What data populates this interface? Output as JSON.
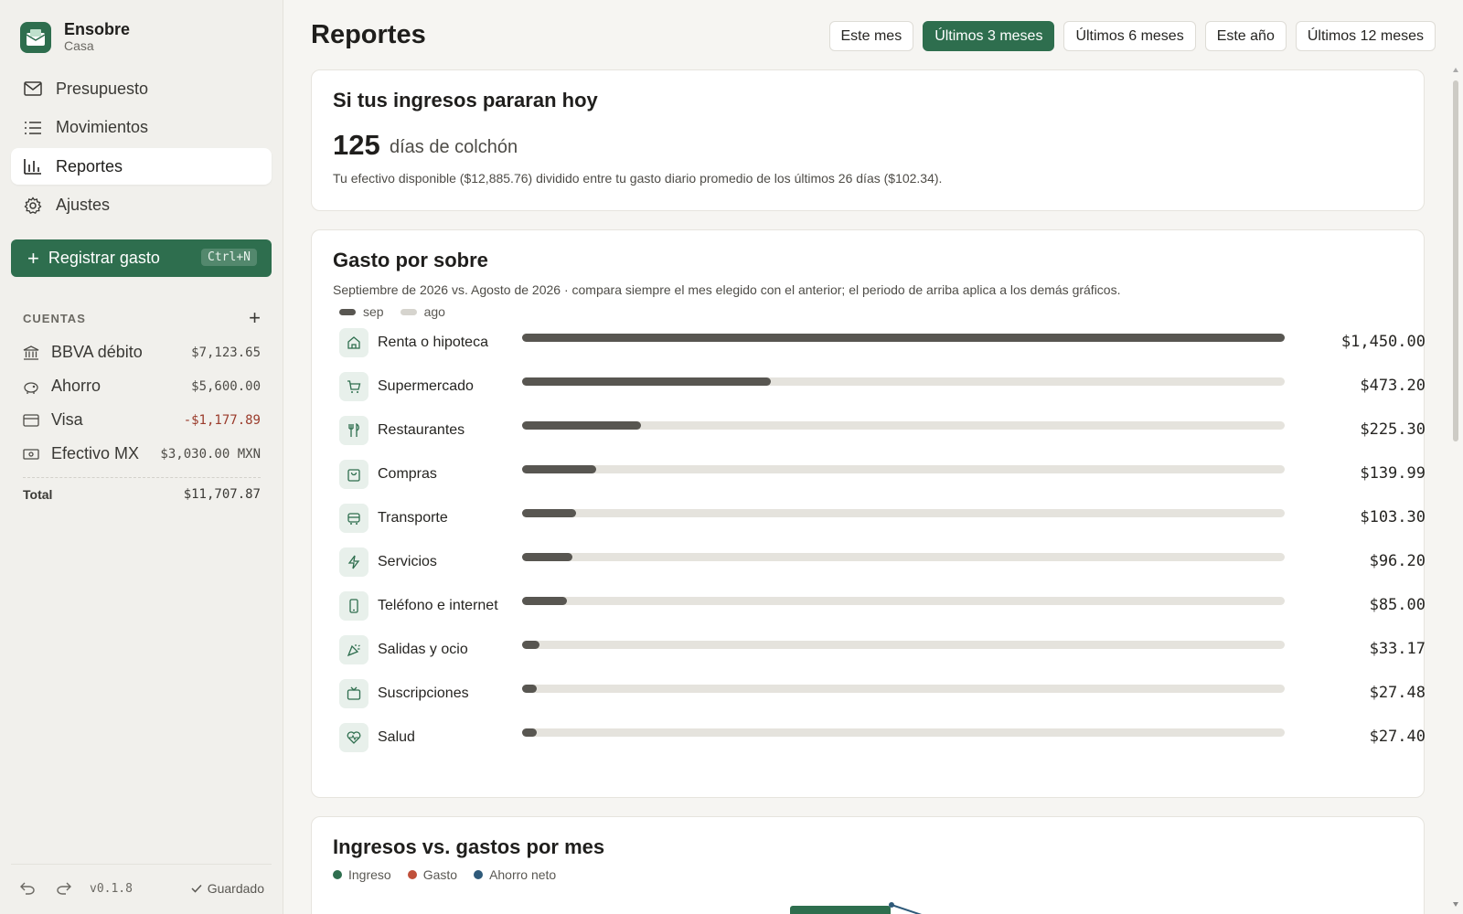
{
  "brand": {
    "name": "Ensobre",
    "subtitle": "Casa"
  },
  "nav": [
    {
      "label": "Presupuesto",
      "icon": "envelope-icon",
      "active": false
    },
    {
      "label": "Movimientos",
      "icon": "list-icon",
      "active": false
    },
    {
      "label": "Reportes",
      "icon": "bar-chart-icon",
      "active": true
    },
    {
      "label": "Ajustes",
      "icon": "gear-icon",
      "active": false
    }
  ],
  "cta": {
    "label": "Registrar gasto",
    "shortcut": "Ctrl+N"
  },
  "accounts": {
    "title": "CUENTAS",
    "items": [
      {
        "name": "BBVA débito",
        "balance": "$7,123.65",
        "icon": "bank-icon",
        "negative": false
      },
      {
        "name": "Ahorro",
        "balance": "$5,600.00",
        "icon": "piggy-bank-icon",
        "negative": false
      },
      {
        "name": "Visa",
        "balance": "-$1,177.89",
        "icon": "credit-card-icon",
        "negative": true
      },
      {
        "name": "Efectivo MX",
        "balance": "$3,030.00 MXN",
        "icon": "cash-icon",
        "negative": false
      }
    ],
    "total_label": "Total",
    "total_value": "$11,707.87"
  },
  "footer": {
    "version": "v0.1.8",
    "saved": "Guardado"
  },
  "page_title": "Reportes",
  "periods": [
    {
      "label": "Este mes",
      "active": false
    },
    {
      "label": "Últimos 3 meses",
      "active": true
    },
    {
      "label": "Últimos 6 meses",
      "active": false
    },
    {
      "label": "Este año",
      "active": false
    },
    {
      "label": "Últimos 12 meses",
      "active": false
    }
  ],
  "cushion": {
    "title": "Si tus ingresos pararan hoy",
    "days": "125",
    "days_suffix": "días de colchón",
    "note": "Tu efectivo disponible ($12,885.76) dividido entre tu gasto diario promedio de los últimos 26 días ($102.34)."
  },
  "envelope_spend": {
    "title": "Gasto por sobre",
    "subtitle": "Septiembre de 2026 vs. Agosto de 2026 · compara siempre el mes elegido con el anterior; el periodo de arriba aplica a los demás gráficos.",
    "legend": [
      {
        "label": "sep",
        "color": "#585651"
      },
      {
        "label": "ago",
        "color": "#d6d4ce"
      }
    ],
    "rows": [
      {
        "label": "Renta o hipoteca",
        "value": "$1,450.00",
        "amount": 1450.0,
        "icon": "home-icon"
      },
      {
        "label": "Supermercado",
        "value": "$473.20",
        "amount": 473.2,
        "icon": "cart-icon"
      },
      {
        "label": "Restaurantes",
        "value": "$225.30",
        "amount": 225.3,
        "icon": "utensils-icon"
      },
      {
        "label": "Compras",
        "value": "$139.99",
        "amount": 139.99,
        "icon": "shopping-bag-icon"
      },
      {
        "label": "Transporte",
        "value": "$103.30",
        "amount": 103.3,
        "icon": "bus-icon"
      },
      {
        "label": "Servicios",
        "value": "$96.20",
        "amount": 96.2,
        "icon": "bolt-icon"
      },
      {
        "label": "Teléfono e internet",
        "value": "$85.00",
        "amount": 85.0,
        "icon": "phone-icon"
      },
      {
        "label": "Salidas y ocio",
        "value": "$33.17",
        "amount": 33.17,
        "icon": "party-icon"
      },
      {
        "label": "Suscripciones",
        "value": "$27.48",
        "amount": 27.48,
        "icon": "tv-icon"
      },
      {
        "label": "Salud",
        "value": "$27.40",
        "amount": 27.4,
        "icon": "heart-pulse-icon"
      }
    ],
    "max_amount": 1450.0
  },
  "income_vs_expense": {
    "title": "Ingresos vs. gastos por mes",
    "legend": [
      {
        "label": "Ingreso",
        "color": "#2e6e4e"
      },
      {
        "label": "Gasto",
        "color": "#c0503a"
      },
      {
        "label": "Ahorro neto",
        "color": "#2f5a7a"
      }
    ]
  },
  "colors": {
    "accent": "#2e6e4e",
    "negative": "#9a3b2b",
    "bar_current": "#585651",
    "bar_track": "#e5e3dd"
  }
}
